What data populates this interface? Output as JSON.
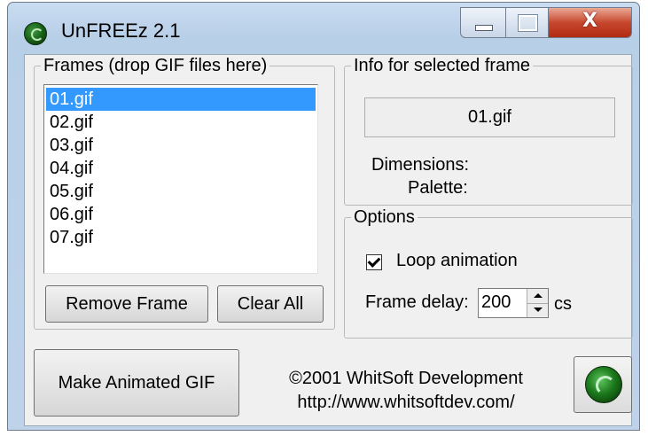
{
  "window": {
    "title": "UnFREEz 2.1",
    "minimize_label": "",
    "maximize_label": "",
    "close_glyph": "X"
  },
  "frames": {
    "group_label": "Frames (drop GIF files here)",
    "items": [
      "01.gif",
      "02.gif",
      "03.gif",
      "04.gif",
      "05.gif",
      "06.gif",
      "07.gif"
    ],
    "selected": "01.gif",
    "remove_label": "Remove Frame",
    "clear_label": "Clear All"
  },
  "info": {
    "group_label": "Info for selected frame",
    "filename": "01.gif",
    "dimensions_label": "Dimensions:",
    "palette_label": "Palette:"
  },
  "options": {
    "group_label": "Options",
    "loop_label": "Loop animation",
    "loop_checked": true,
    "delay_label": "Frame delay:",
    "delay_value": "200",
    "delay_unit": "cs"
  },
  "footer": {
    "make_label": "Make Animated GIF",
    "credit_line1": "©2001 WhitSoft Development",
    "credit_line2": "http://www.whitsoftdev.com/"
  },
  "icons": {
    "app": "unfreez-logo-icon",
    "logo_button": "whitsoft-logo-icon"
  },
  "colors": {
    "selection": "#3399ff",
    "close_button": "#c7472e",
    "logo_green": "#1c7a1c"
  }
}
